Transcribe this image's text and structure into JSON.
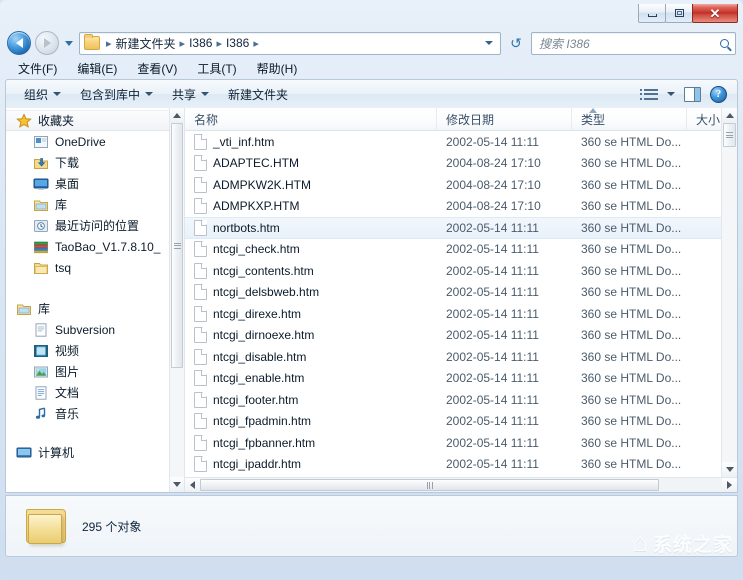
{
  "window": {
    "buttons": {
      "minimize": "─",
      "maximize": "□",
      "close": "✕"
    }
  },
  "address": {
    "back_tooltip": "后退",
    "forward_tooltip": "前进",
    "crumbs": [
      "新建文件夹",
      "I386",
      "I386"
    ],
    "separator": "▸",
    "refresh_glyph": "↺"
  },
  "search": {
    "placeholder": "搜索 I386"
  },
  "menubar": {
    "items": [
      {
        "label": "文件(F)"
      },
      {
        "label": "编辑(E)"
      },
      {
        "label": "查看(V)"
      },
      {
        "label": "工具(T)"
      },
      {
        "label": "帮助(H)"
      }
    ]
  },
  "commandbar": {
    "items": [
      {
        "label": "组织",
        "has_caret": true
      },
      {
        "label": "包含到库中",
        "has_caret": true
      },
      {
        "label": "共享",
        "has_caret": true
      },
      {
        "label": "新建文件夹",
        "has_caret": false
      }
    ],
    "help_label": "?"
  },
  "sidebar": {
    "groups": [
      {
        "header": {
          "label": "收藏夹",
          "icon": "star-icon",
          "selected": true
        },
        "items": [
          {
            "label": "OneDrive",
            "icon": "onedrive-icon"
          },
          {
            "label": "下载",
            "icon": "downloads-icon"
          },
          {
            "label": "桌面",
            "icon": "desktop-icon"
          },
          {
            "label": "库",
            "icon": "library-icon"
          },
          {
            "label": "最近访问的位置",
            "icon": "recent-places-icon"
          },
          {
            "label": "TaoBao_V1.7.8.10_",
            "icon": "stack-icon"
          },
          {
            "label": "tsq",
            "icon": "folder-icon"
          }
        ]
      },
      {
        "header": {
          "label": "库",
          "icon": "library-icon",
          "selected": false
        },
        "items": [
          {
            "label": "Subversion",
            "icon": "document-icon"
          },
          {
            "label": "视频",
            "icon": "video-icon"
          },
          {
            "label": "图片",
            "icon": "pictures-icon"
          },
          {
            "label": "文档",
            "icon": "documents-icon"
          },
          {
            "label": "音乐",
            "icon": "music-icon"
          }
        ]
      },
      {
        "header": {
          "label": "计算机",
          "icon": "computer-icon",
          "selected": false
        },
        "items": []
      }
    ]
  },
  "filelist": {
    "columns": [
      {
        "key": "name",
        "label": "名称"
      },
      {
        "key": "date",
        "label": "修改日期"
      },
      {
        "key": "type",
        "label": "类型"
      },
      {
        "key": "size",
        "label": "大小"
      }
    ],
    "rows": [
      {
        "name": "_vti_inf.htm",
        "date": "2002-05-14 11:11",
        "type": "360 se HTML Do...",
        "selected": false
      },
      {
        "name": "ADAPTEC.HTM",
        "date": "2004-08-24 17:10",
        "type": "360 se HTML Do...",
        "selected": false
      },
      {
        "name": "ADMPKW2K.HTM",
        "date": "2004-08-24 17:10",
        "type": "360 se HTML Do...",
        "selected": false
      },
      {
        "name": "ADMPKXP.HTM",
        "date": "2004-08-24 17:10",
        "type": "360 se HTML Do...",
        "selected": false
      },
      {
        "name": "nortbots.htm",
        "date": "2002-05-14 11:11",
        "type": "360 se HTML Do...",
        "selected": true
      },
      {
        "name": "ntcgi_check.htm",
        "date": "2002-05-14 11:11",
        "type": "360 se HTML Do...",
        "selected": false
      },
      {
        "name": "ntcgi_contents.htm",
        "date": "2002-05-14 11:11",
        "type": "360 se HTML Do...",
        "selected": false
      },
      {
        "name": "ntcgi_delsbweb.htm",
        "date": "2002-05-14 11:11",
        "type": "360 se HTML Do...",
        "selected": false
      },
      {
        "name": "ntcgi_direxe.htm",
        "date": "2002-05-14 11:11",
        "type": "360 se HTML Do...",
        "selected": false
      },
      {
        "name": "ntcgi_dirnoexe.htm",
        "date": "2002-05-14 11:11",
        "type": "360 se HTML Do...",
        "selected": false
      },
      {
        "name": "ntcgi_disable.htm",
        "date": "2002-05-14 11:11",
        "type": "360 se HTML Do...",
        "selected": false
      },
      {
        "name": "ntcgi_enable.htm",
        "date": "2002-05-14 11:11",
        "type": "360 se HTML Do...",
        "selected": false
      },
      {
        "name": "ntcgi_footer.htm",
        "date": "2002-05-14 11:11",
        "type": "360 se HTML Do...",
        "selected": false
      },
      {
        "name": "ntcgi_fpadmin.htm",
        "date": "2002-05-14 11:11",
        "type": "360 se HTML Do...",
        "selected": false
      },
      {
        "name": "ntcgi_fpbanner.htm",
        "date": "2002-05-14 11:11",
        "type": "360 se HTML Do...",
        "selected": false
      },
      {
        "name": "ntcgi_ipaddr.htm",
        "date": "2002-05-14 11:11",
        "type": "360 se HTML Do...",
        "selected": false
      }
    ]
  },
  "statusbar": {
    "item_count_text": "295 个对象"
  },
  "watermark": {
    "text": "系统之家"
  },
  "colors": {
    "accent": "#2a6ca8",
    "close_button": "#c2302a",
    "selection": "#e8f1fa",
    "window_chrome": "#dbe7f4"
  }
}
